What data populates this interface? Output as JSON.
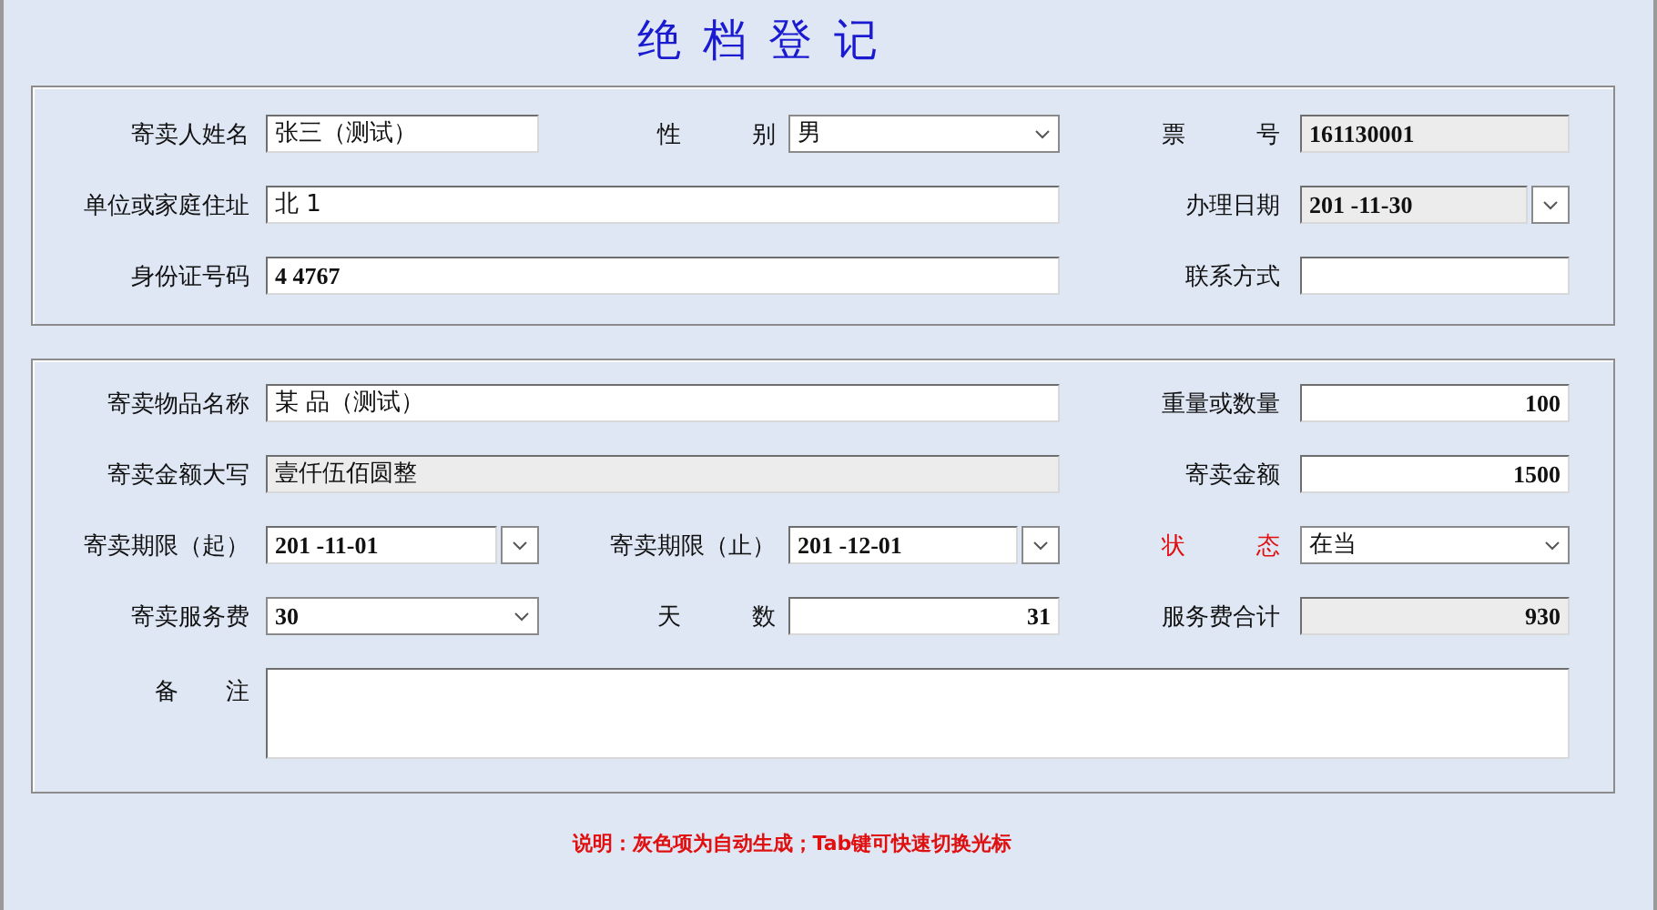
{
  "title": "绝档登记",
  "sections": [
    {
      "rows": [
        [
          {
            "label": "寄卖人姓名",
            "kind": "text",
            "value": "张三（测试）",
            "disabled": false,
            "highlighted": false
          },
          {
            "label": "性　　　别",
            "kind": "combo",
            "value": "男",
            "disabled": false,
            "highlighted": false
          },
          {
            "label": "票　　　号",
            "kind": "text",
            "value": "161130001",
            "disabled": true,
            "highlighted": false
          }
        ],
        [
          {
            "label": "单位或家庭住址",
            "kind": "text",
            "value": "北 1",
            "disabled": false,
            "highlighted": false
          },
          {
            "label": "办理日期",
            "kind": "date",
            "value": "201 -11-30",
            "disabled": true,
            "highlighted": false
          }
        ],
        [
          {
            "label": "身份证号码",
            "kind": "text",
            "value": "4 4767",
            "disabled": false,
            "highlighted": false
          },
          {
            "label": "联系方式",
            "kind": "text",
            "disabled": false,
            "highlighted": false
          }
        ]
      ]
    },
    {
      "rows": [
        [
          {
            "label": "寄卖物品名称",
            "kind": "text",
            "value": "某 品（测试）",
            "disabled": false,
            "highlighted": false
          },
          {
            "label": "重量或数量",
            "kind": "number",
            "value": "100",
            "disabled": false,
            "highlighted": false
          }
        ],
        [
          {
            "label": "寄卖金额大写",
            "kind": "text",
            "value": "壹仟伍佰圆整",
            "disabled": true,
            "highlighted": false
          },
          {
            "label": "寄卖金额",
            "kind": "number",
            "value": "1500",
            "disabled": false,
            "highlighted": false
          }
        ],
        [
          {
            "label": "寄卖期限（起）",
            "kind": "date",
            "value": "201 -11-01",
            "disabled": false,
            "highlighted": false
          },
          {
            "label": "寄卖期限（止）",
            "kind": "date",
            "value": "201 -12-01",
            "disabled": false,
            "highlighted": false
          },
          {
            "label": "状　　　态",
            "kind": "combo",
            "value": "在当",
            "disabled": false,
            "highlighted": true
          }
        ],
        [
          {
            "label": "寄卖服务费",
            "kind": "combo",
            "value": "30",
            "disabled": false,
            "highlighted": false
          },
          {
            "label": "天　　　数",
            "kind": "number",
            "value": "31",
            "disabled": false,
            "highlighted": false
          },
          {
            "label": "服务费合计",
            "kind": "number",
            "value": "930",
            "disabled": true,
            "highlighted": false
          }
        ],
        [
          {
            "label": "备　　注",
            "kind": "memo",
            "disabled": false,
            "highlighted": false
          }
        ]
      ]
    }
  ],
  "note": "说明：灰色项为自动生成；Tab键可快速切换光标"
}
